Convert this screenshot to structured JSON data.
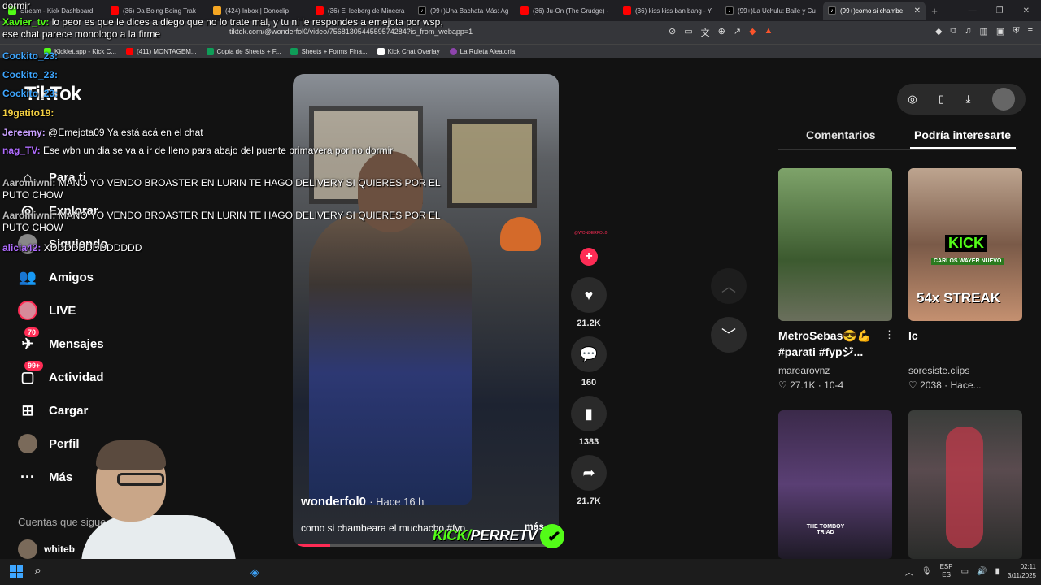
{
  "browser": {
    "tabs": [
      {
        "label": "Stream - Kick Dashboard",
        "favicon_color": "#53fc18",
        "active": false
      },
      {
        "label": "(36) Da Boing Boing Trak",
        "favicon_color": "#ff0000",
        "active": false
      },
      {
        "label": "(424) Inbox | Donoclip",
        "favicon_color": "#f5a623",
        "active": false
      },
      {
        "label": "(36) El Iceberg de Minecra",
        "favicon_color": "#ff0000",
        "active": false
      },
      {
        "label": "(99+)Una Bachata Más: Ag",
        "favicon_color": "#000000",
        "active": false
      },
      {
        "label": "(36) Ju-On (The Grudge) -",
        "favicon_color": "#ff0000",
        "active": false
      },
      {
        "label": "(36) kiss kiss ban bang - Y",
        "favicon_color": "#ff0000",
        "active": false
      },
      {
        "label": "(99+)La Uchulu: Baile y Cu",
        "favicon_color": "#000000",
        "active": false
      },
      {
        "label": "(99+)como si chambe",
        "favicon_color": "#000000",
        "active": true
      }
    ],
    "url": "tiktok.com/@wonderfol0/video/7568130544559574284?is_from_webapp=1",
    "bookmarks": [
      {
        "label": "Kicklet.app - Kick C...",
        "color": "#53fc18"
      },
      {
        "label": "(411) MONTAGEM...",
        "color": "#ff0000"
      },
      {
        "label": "Copia de Sheets + F...",
        "color": "#0f9d58"
      },
      {
        "label": "Sheets + Forms Fina...",
        "color": "#0f9d58"
      },
      {
        "label": "Kick Chat Overlay",
        "color": "#ffffff"
      },
      {
        "label": "La Ruleta Aleatoria",
        "color": "#8e44ad"
      }
    ]
  },
  "tiktok": {
    "logo": "TikTok",
    "nav": [
      {
        "label": "Para ti",
        "icon": "home-icon"
      },
      {
        "label": "Explorar",
        "icon": "compass-icon"
      },
      {
        "label": "Siguiendo",
        "icon": "following-icon"
      },
      {
        "label": "Amigos",
        "icon": "friends-icon"
      },
      {
        "label": "LIVE",
        "icon": "live-icon"
      },
      {
        "label": "Mensajes",
        "icon": "messages-icon",
        "badge": "70"
      },
      {
        "label": "Actividad",
        "icon": "activity-icon",
        "badge": "99+"
      },
      {
        "label": "Cargar",
        "icon": "upload-icon"
      },
      {
        "label": "Perfil",
        "icon": "profile-icon"
      },
      {
        "label": "Más",
        "icon": "more-icon"
      }
    ],
    "suggested_title": "Cuentas que sigue",
    "suggested_user": "whiteb",
    "video": {
      "author": "wonderfol0",
      "time": "· Hace 16 h",
      "description": "como si chambeara el muchacho #fyp",
      "more": "más",
      "progress": 0.14
    },
    "actions": {
      "likes": "21.2K",
      "comments": "160",
      "saves": "1383",
      "shares": "21.7K"
    },
    "right_panel": {
      "tab_comments": "Comentarios",
      "tab_suggested": "Podría interesarte",
      "items": [
        {
          "caption": "MetroSebas😎💪 #parati #fypジ...",
          "user": "marearovnz",
          "likes": "27.1K",
          "date": "10-4"
        },
        {
          "caption": "Ic",
          "user": "soresiste.clips",
          "likes": "2038",
          "date": "Hace..."
        }
      ],
      "thumb_text_kick": "KICK",
      "thumb_text_nuevo": "CARLOS WAYER NUEVO",
      "thumb_text_streak": "54x STREAK",
      "thumb_text_triad": "THE TOMBOY TRIAD"
    }
  },
  "chat": [
    {
      "user": "",
      "text": "dormir",
      "color": "#ffffff"
    },
    {
      "user": "Xavier_tv:",
      "text": " lo peor es que le dices a diego que no lo trate mal, y tu ni le respondes a emejota por wsp, ese chat parece monologo a la firme",
      "color": "#53fc18"
    },
    {
      "user": "Cockito_23:",
      "text": "",
      "color": "#3ea6ff"
    },
    {
      "user": "Cockito_23:",
      "text": "",
      "color": "#3ea6ff"
    },
    {
      "user": "Cockito_23:",
      "text": "",
      "color": "#3ea6ff"
    },
    {
      "user": "19gatito19:",
      "text": "",
      "color": "#f5d142"
    },
    {
      "user": "Jereemy:",
      "text": " @Emejota09 Ya está acá en el chat",
      "color": "#c9a0ff"
    },
    {
      "user": "nag_TV:",
      "text": " Ese wbn un dia se va a ir de lleno para abajo del puente primavera por no dormir",
      "color": "#b06cff"
    },
    {
      "user": "Aaromiwni:",
      "text": " MANO YO VENDO BROASTER EN LURIN TE HAGO DELIVERY SI QUIERES POR EL PUTO CHOW",
      "color": "#bbbbbb"
    },
    {
      "user": "Aaromiwni:",
      "text": " MANO YO VENDO BROASTER EN LURIN TE HAGO DELIVERY SI QUIERES POR EL PUTO CHOW",
      "color": "#bbbbbb"
    },
    {
      "user": "alicia42:",
      "text": " XDDDDDDDDDDDDD",
      "color": "#b06cff"
    }
  ],
  "stream_overlay": {
    "kick_prefix": "KICK/",
    "kick_name": "PERRETV"
  },
  "taskbar": {
    "lang_top": "ESP",
    "lang_bottom": "ES",
    "time": "02:11",
    "date": "3/11/2025"
  }
}
